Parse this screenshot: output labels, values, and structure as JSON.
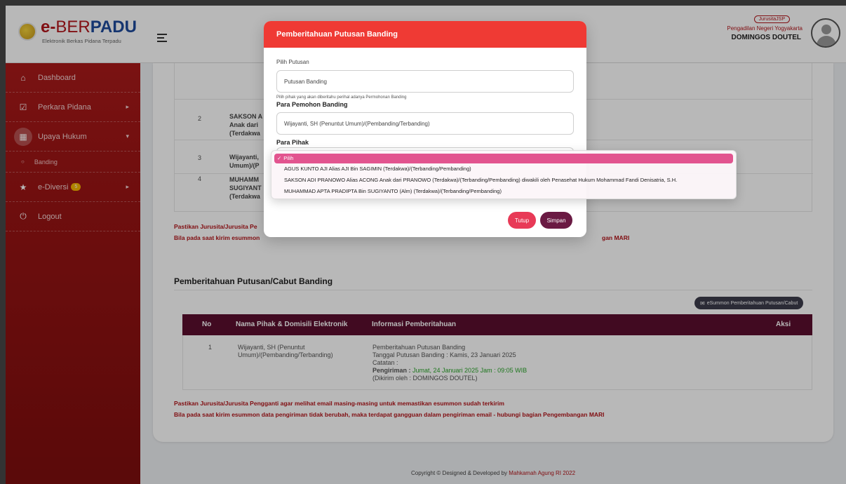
{
  "app": {
    "logo_prefix": "e-",
    "logo_mid": "BER",
    "logo_end": "PADU",
    "logo_subtitle": "Elektronik Berkas Pidana Terpadu"
  },
  "sidebar": {
    "items": [
      {
        "label": "Dashboard",
        "icon": "home-icon"
      },
      {
        "label": "Perkara Pidana",
        "icon": "checkbox-icon"
      },
      {
        "label": "Upaya Hukum",
        "icon": "file-icon"
      },
      {
        "label": "Banding",
        "icon": "circle-icon"
      },
      {
        "label": "e-Diversi",
        "icon": "star-icon",
        "badge": "5"
      },
      {
        "label": "Logout",
        "icon": "power-icon"
      }
    ]
  },
  "header": {
    "role": "JurusitaJSP",
    "court": "Pengadilan Negeri Yogyakarta",
    "user": "DOMINGOS DOUTEL"
  },
  "background_table": {
    "rows": [
      {
        "no": "2",
        "name": "SAKSON A\nAnak dari\n(Terdakwa"
      },
      {
        "no": "3",
        "name": "Wijayanti,\nUmum)/(P"
      },
      {
        "no": "4",
        "name": "MUHAMM\nSUGIYANT\n(Terdakwa"
      }
    ]
  },
  "warnings": {
    "top_line1": "Pastikan Jurusita/Jurusita Pe",
    "top_line2_a": "Bila pada saat kirim esummon",
    "top_line2_b": "gan MARI",
    "line1": "Pastikan Jurusita/Jurusita Pengganti agar melihat email masing-masing untuk memastikan esummon sudah terkirim",
    "line2": "Bila pada saat kirim esummon data pengiriman tidak berubah, maka terdapat gangguan dalam pengiriman email - hubungi bagian Pengembangan MARI"
  },
  "section": {
    "title": "Pemberitahuan Putusan/Cabut Banding",
    "esummon_button": "eSummon Pemberitahuan Putusan/Cabut",
    "columns": [
      "No",
      "Nama Pihak & Domisili Elektronik",
      "Informasi Pemberitahuan",
      "Aksi"
    ],
    "row": {
      "no": "1",
      "name_line1": "Wijayanti, SH (Penuntut",
      "name_line2": "Umum)/(Pembanding/Terbanding)",
      "info_line1": "Pemberitahuan Putusan Banding",
      "info_line2": "Tanggal Putusan Banding : Kamis, 23 Januari 2025",
      "info_line3": "Catatan :",
      "info_label": "Pengiriman :",
      "info_sent": " Jumat, 24 Januari 2025 Jam : 09:05 WIB",
      "info_line5": "(Dikirim oleh : DOMINGOS DOUTEL)"
    }
  },
  "footer": {
    "text": "Copyright © Designed & Developed by ",
    "link": "Mahkamah Agung RI 2022"
  },
  "modal": {
    "title": "Pemberitahuan Putusan Banding",
    "field1_label": "Pilih Putusan",
    "field1_value": "Putusan Banding",
    "help_text": "Pilih pihak yang akan diberitahu perihal adanya Permohonan Banding",
    "field2_label": "Para Pemohon Banding",
    "field2_value": "Wijayanti, SH (Penuntut Umum)/(Pembanding/Terbanding)",
    "field3_label": "Para Pihak",
    "close_button": "Tutup",
    "save_button": "Simpan"
  },
  "dropdown": {
    "options": [
      "Pilih",
      "AGUS KUNTO AJI Alias AJI Bin SAGIMIN (Terdakwa)/(Terbanding/Pembanding)",
      "SAKSON ADI PRANOWO Alias ACONG Anak dari PRANOWO (Terdakwa)/(Terbanding/Pembanding) diwakili oleh Penasehat Hukum Mohammad Fandi Denisatria, S.H.",
      "MUHAMMAD APTA PRADIPTA Bin SUGIYANTO (Alm) (Terdakwa)/(Terbanding/Pembanding)"
    ],
    "selected": "Pilih"
  }
}
